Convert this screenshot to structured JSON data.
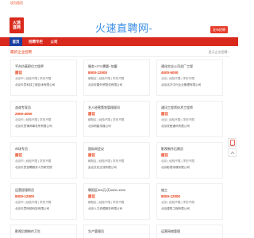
{
  "topbar": {
    "link": "设为首页"
  },
  "header": {
    "logo_line1": "火速",
    "logo_line2": "直聘",
    "site_title": "火速直聘网-",
    "login_label": "发布招聘"
  },
  "nav": {
    "items": [
      {
        "label": "首页",
        "active": true
      },
      {
        "label": "招聘专栏",
        "active": false
      },
      {
        "label": "公司",
        "active": false
      }
    ]
  },
  "section": {
    "title": "最新企业招聘",
    "more": "显示企业招聘 ›"
  },
  "cards": [
    {
      "title": "平台仿真职位工程师",
      "salary": "面议",
      "meta": "北京市 | 经验不限 | 学历不限",
      "company": "北京天意科技工程技术有限公司"
    },
    {
      "title": "服务+ZTO需要+加盟",
      "salary": "8000-12000",
      "meta": "朝阳区 | 经验不限 | 学历不限",
      "company": "北京安康外贸物流有限公司"
    },
    {
      "title": "通化实业公司总厂工程",
      "salary": "4000-5000",
      "meta": "北京 | 经验不限 | 学历不限",
      "company": "北京北方中兴企业管理有限公司"
    },
    {
      "title": "咨询专家员",
      "salary": "2000-4000",
      "meta": "北京市 | 经验不限 | 学历不限",
      "company": "北京天意律师事务所有限公司"
    },
    {
      "title": "艺人经营策划管理顾问",
      "salary": "面议",
      "meta": "朝阳区 | 经验不限 | 学历不限",
      "company": "北京明星传媒公司"
    },
    {
      "title": "通讯工程师技术工程师",
      "salary": "面议",
      "meta": "北京 | 经验不限 | 学历不限",
      "company": "北京双鱼通讯有限公司"
    },
    {
      "title": "市场专员",
      "salary": "面议",
      "meta": "北京市 | 经验不限 | 学历不限",
      "company": "北京天意招聘服务人员研究院"
    },
    {
      "title": "国际网会议",
      "salary": "面议",
      "meta": "朝阳区 | 经验不限 | 学历不限",
      "company": "会议文化交流有限公司"
    },
    {
      "title": "影视制作后期员",
      "salary": "面议",
      "meta": "北京 | 经验不限 | 学历不限",
      "company": "北京影视传媒有限公司"
    },
    {
      "title": "运营经理职员",
      "salary": "8000-12000",
      "meta": "北京市 | 经验不限 | 学历不限",
      "company": "北京天意网络科技有限公司"
    },
    {
      "title": "朝阳区500元/天0000-1000",
      "salary": "面议",
      "meta": "朝阳区 | 经验不限 | 学历不限",
      "company": "北京人力资源服务有限公司"
    },
    {
      "title": "施工",
      "salary": "8000-12000",
      "meta": "北京 | 经验不限 | 学历不限",
      "company": "北京建筑工程有限公司"
    }
  ],
  "partial_row": [
    {
      "title": "影视后期制作卫生"
    },
    {
      "title": "生产管理员"
    },
    {
      "title": "运营网络管理"
    }
  ],
  "side": {
    "phone_icon": "phone-icon",
    "top_icon": "back-to-top-icon"
  },
  "colors": {
    "brand_red": "#d9281c",
    "accent_blue": "#3a8ee6",
    "nav_active": "#1b3fa0",
    "salary_red": "#e8380d"
  }
}
